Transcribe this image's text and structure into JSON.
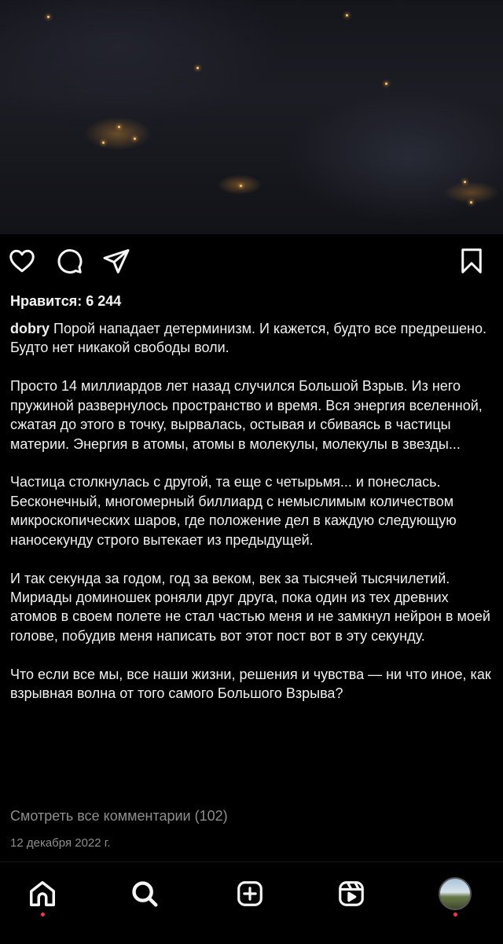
{
  "post": {
    "likes": "Нравится: 6 244",
    "username": "dobry",
    "caption_first": "Порой нападает детерминизм. И кажется, будто все предрешено. Будто нет никакой свободы воли.",
    "paragraphs": [
      "Просто 14 миллиардов лет назад случился Большой Взрыв. Из него пружиной развернулось пространство и время. Вся энергия вселенной, сжатая до этого в точку, вырвалась, остывая и сбиваясь в частицы материи. Энергия в атомы, атомы в молекулы, молекулы в звезды...",
      "Частица столкнулась с другой, та еще с четырьмя... и понеслась. Бесконечный, многомерный биллиард с немыслимым количеством микроскопических шаров, где положение дел в каждую следующую наносекунду строго вытекает из предыдущей.",
      "И так секунда за годом, год за веком, век за тысячей тысячилетий. Мириады доминошек роняли друг друга, пока один из тех древних атомов в своем полете не стал частью меня и не замкнул нейрон в моей голове, побудив меня написать вот этот пост вот в эту секунду.",
      "Что если все мы, все наши жизни, решения и чувства — ни что иное, как взрывная волна от того самого Большого Взрыва?"
    ],
    "view_comments": "Смотреть все комментарии (102)",
    "date": "12 декабря 2022 г."
  },
  "actions": {
    "like_icon": "heart-icon",
    "comment_icon": "comment-icon",
    "share_icon": "send-icon",
    "save_icon": "bookmark-icon"
  },
  "tabbar": {
    "items": [
      "home-icon",
      "search-icon",
      "create-icon",
      "reels-icon",
      "profile-avatar"
    ],
    "notification_color": "#ff3040"
  }
}
